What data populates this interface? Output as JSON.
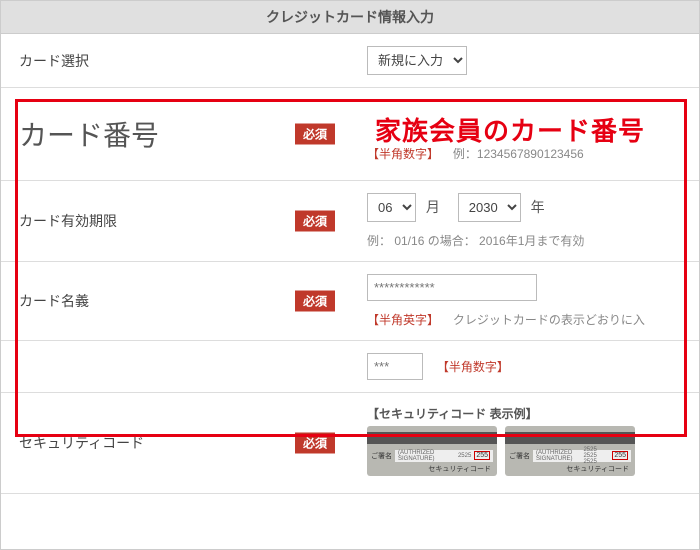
{
  "header": {
    "title": "クレジットカード情報入力"
  },
  "badge": {
    "required": "必須"
  },
  "rows": {
    "card_select": {
      "label": "カード選択",
      "selected": "新規に入力"
    },
    "card_number": {
      "label": "カード番号",
      "format_hint": "【半角数字】",
      "example": "例：1234567890123456"
    },
    "expiry": {
      "label": "カード有効期限",
      "month_selected": "06",
      "month_suffix": "月",
      "year_selected": "2030",
      "year_suffix": "年",
      "example": "例： 01/16 の場合： 2016年1月まで有効"
    },
    "holder": {
      "label": "カード名義",
      "placeholder": "************",
      "format_hint": "【半角英字】",
      "note": "クレジットカードの表示どおりに入"
    },
    "cvv": {
      "placeholder": "***",
      "format_hint": "【半角数字】"
    },
    "security": {
      "label": "セキュリティコード",
      "example_title": "【セキュリティコード 表示例】",
      "sig_label": "ご署名",
      "sig_text": "(AUTHRIZED SIGNATURE)",
      "digits_a": "2525",
      "digits_b": "2525 2525 2525",
      "cvv_sample": "255",
      "caption": "セキュリティコード"
    }
  },
  "annotation": {
    "text": "家族会員のカード番号"
  }
}
